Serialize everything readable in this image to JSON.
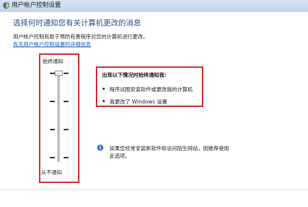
{
  "window": {
    "title": "用户帐户控制设置",
    "icon": "shield-icon"
  },
  "heading": "选择何时通知您有关计算机更改的消息",
  "description": "用户帐户控制有助于预防有害程序对您的计算机进行更改。",
  "help_link": "有关用户帐户控制设置的详细信息",
  "slider": {
    "top_label": "始终通知",
    "bottom_label": "从不通知",
    "levels": 4,
    "selected_level": 4
  },
  "notify_box": {
    "heading": "出现以下情况时始终通知我:",
    "items": [
      "程序试图安装软件或更改我的计算机",
      "我更改了 Windows 设置"
    ]
  },
  "info_note": {
    "icon": "info-icon",
    "lines": [
      "如果您经常安装新软件和访问陌生网站，则推荐使用",
      "此选项。"
    ]
  },
  "highlight_color": "#d8222b",
  "heading_color": "#1e4f8a",
  "link_color": "#1560b8"
}
